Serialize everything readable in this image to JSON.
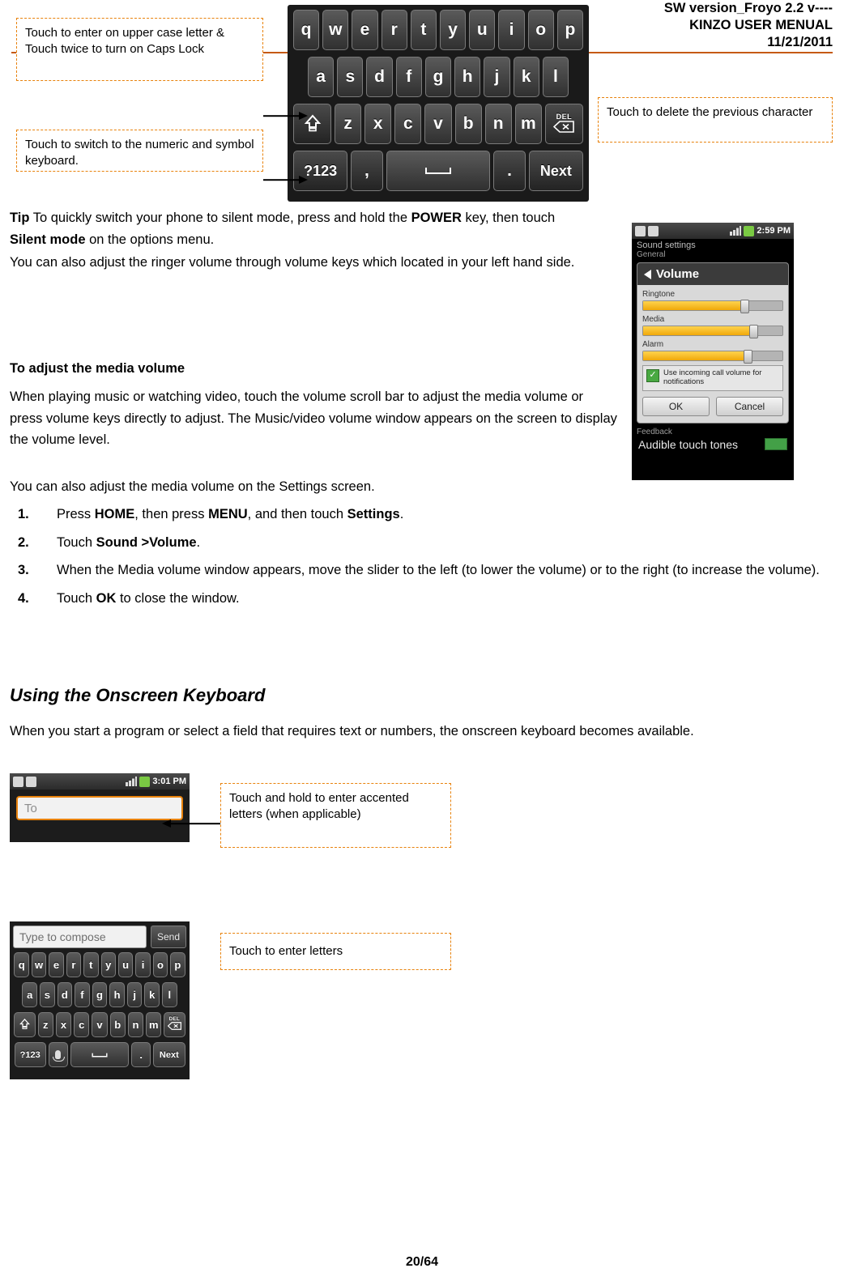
{
  "header": {
    "line1": "SW version_Froyo 2.2 v----",
    "line2": "KINZO USER MENUAL",
    "line3": "11/21/2011"
  },
  "callouts": {
    "upper_case": "Touch to enter on upper case letter & Touch twice to turn on Caps Lock",
    "numeric": "Touch to switch to the numeric and symbol keyboard.",
    "delete": "Touch to delete the previous character",
    "accented": "Touch and hold to enter accented letters (when applicable)",
    "letters": "Touch to enter letters"
  },
  "keyboard": {
    "row1": [
      "q",
      "w",
      "e",
      "r",
      "t",
      "y",
      "u",
      "i",
      "o",
      "p"
    ],
    "row2": [
      "a",
      "s",
      "d",
      "f",
      "g",
      "h",
      "j",
      "k",
      "l"
    ],
    "row3": [
      "z",
      "x",
      "c",
      "v",
      "b",
      "n",
      "m"
    ],
    "shift_label": "",
    "del_label": "DEL",
    "num_label": "?123",
    "comma_label": ",",
    "space_label": "",
    "period_label": ".",
    "next_label": "Next"
  },
  "body": {
    "tip_prefix": "Tip",
    "tip_line1_a": " To quickly switch your phone to silent mode, press and hold the ",
    "tip_power": "POWER",
    "tip_line1_b": " key, then touch ",
    "tip_silent": "Silent mode",
    "tip_line1_c": " on the options menu.",
    "tip_line2": "You can also adjust the ringer volume through volume keys which located in your left hand side.",
    "media_heading": "To adjust the media volume",
    "media_p1": "When playing music or watching video, touch the volume scroll bar to adjust the media volume or press volume keys directly to adjust. The Music/video volume window appears on the screen to display the volume level.",
    "media_p2": "You can also adjust the media volume on the Settings screen.",
    "steps": [
      {
        "num": "1.",
        "parts": [
          {
            "t": "Press ",
            "b": false
          },
          {
            "t": "HOME",
            "b": true
          },
          {
            "t": ", then press ",
            "b": false
          },
          {
            "t": "MENU",
            "b": true
          },
          {
            "t": ", and then touch ",
            "b": false
          },
          {
            "t": "Settings",
            "b": true
          },
          {
            "t": ".",
            "b": false
          }
        ]
      },
      {
        "num": "2.",
        "parts": [
          {
            "t": "Touch ",
            "b": false
          },
          {
            "t": "Sound >Volume",
            "b": true
          },
          {
            "t": ".",
            "b": false
          }
        ]
      },
      {
        "num": "3.",
        "parts": [
          {
            "t": "When the Media volume window appears, move the slider to the left (to lower the volume) or to the right (to increase the volume).",
            "b": false
          }
        ]
      },
      {
        "num": "4.",
        "parts": [
          {
            "t": "Touch ",
            "b": false
          },
          {
            "t": "OK",
            "b": true
          },
          {
            "t": " to close the window.",
            "b": false
          }
        ]
      }
    ],
    "section_heading": "Using the Onscreen Keyboard",
    "section_p": "When you start a program or select a field that requires text or numbers, the onscreen keyboard becomes available."
  },
  "settings_shot": {
    "status_time": "2:59 PM",
    "title": "Sound settings",
    "subtitle": "General",
    "volume_title": "Volume",
    "rows": [
      {
        "label": "Ringtone",
        "fill": 72
      },
      {
        "label": "Media",
        "fill": 78
      },
      {
        "label": "Alarm",
        "fill": 74
      }
    ],
    "checkbox_label": "Use incoming call volume for notifications",
    "checkbox_mark": "✓",
    "ok_label": "OK",
    "cancel_label": "Cancel",
    "feedback_label": "Feedback",
    "audible_label": "Audible touch tones"
  },
  "to_shot": {
    "status_time": "3:01 PM",
    "to_placeholder": "To"
  },
  "compose_shot": {
    "input_placeholder": "Type to compose",
    "send_label": "Send"
  },
  "footer": {
    "page": "20/64"
  },
  "colors": {
    "accent_orange": "#E8820C",
    "rule_orange": "#C55A11",
    "key_gray": "#4a4a4a"
  }
}
